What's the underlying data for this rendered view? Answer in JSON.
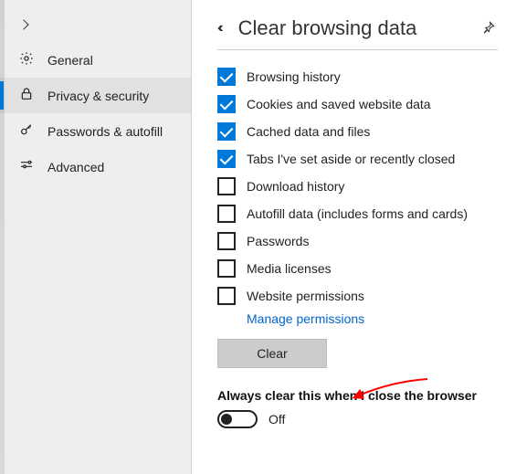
{
  "sidebar": {
    "items": [
      {
        "label": "General",
        "active": false
      },
      {
        "label": "Privacy & security",
        "active": true
      },
      {
        "label": "Passwords & autofill",
        "active": false
      },
      {
        "label": "Advanced",
        "active": false
      }
    ]
  },
  "header": {
    "title": "Clear browsing data"
  },
  "options": [
    {
      "label": "Browsing history",
      "checked": true
    },
    {
      "label": "Cookies and saved website data",
      "checked": true
    },
    {
      "label": "Cached data and files",
      "checked": true
    },
    {
      "label": "Tabs I've set aside or recently closed",
      "checked": true
    },
    {
      "label": "Download history",
      "checked": false
    },
    {
      "label": "Autofill data (includes forms and cards)",
      "checked": false
    },
    {
      "label": "Passwords",
      "checked": false
    },
    {
      "label": "Media licenses",
      "checked": false
    },
    {
      "label": "Website permissions",
      "checked": false
    }
  ],
  "links": {
    "manage_permissions": "Manage permissions"
  },
  "buttons": {
    "clear": "Clear"
  },
  "always_clear": {
    "title": "Always clear this when I close the browser",
    "state": "Off",
    "value": false
  },
  "colors": {
    "accent": "#0078d7",
    "link": "#0066cc"
  }
}
